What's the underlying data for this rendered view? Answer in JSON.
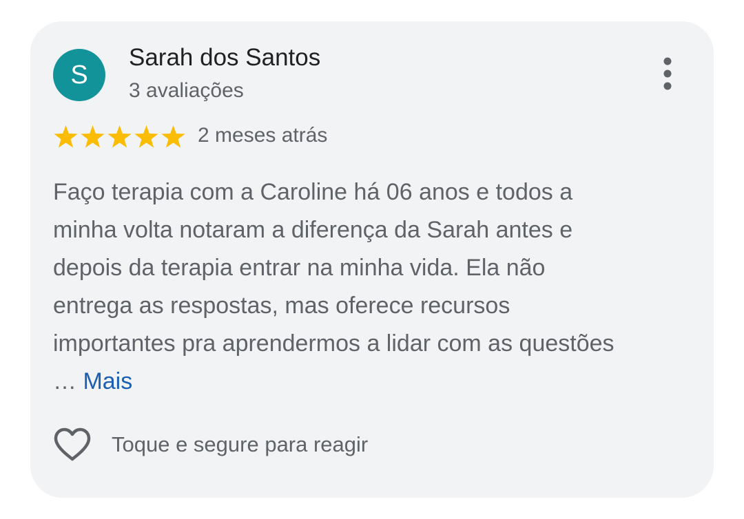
{
  "review": {
    "author": {
      "initial": "S",
      "name": "Sarah dos Santos",
      "review_count": "3 avaliações",
      "avatar_color": "#12939a"
    },
    "menu_icon": "more-vert-icon",
    "rating": {
      "stars": 5,
      "max_stars": 5,
      "star_color": "#fbbc04",
      "date": "2 meses atrás"
    },
    "body_lines": [
      "Faço terapia com a Caroline há 06 anos e todos a",
      "minha volta notaram a diferença da Sarah antes e",
      "depois da terapia entrar na minha vida. Ela não",
      "entrega as respostas, mas oferece recursos",
      "importantes pra aprendermos a lidar com as questões"
    ],
    "ellipsis": "…",
    "more_label": "Mais",
    "more_color": "#1a5fb4",
    "react": {
      "icon": "heart-outline-icon",
      "label": "Toque e segure para reagir"
    }
  }
}
